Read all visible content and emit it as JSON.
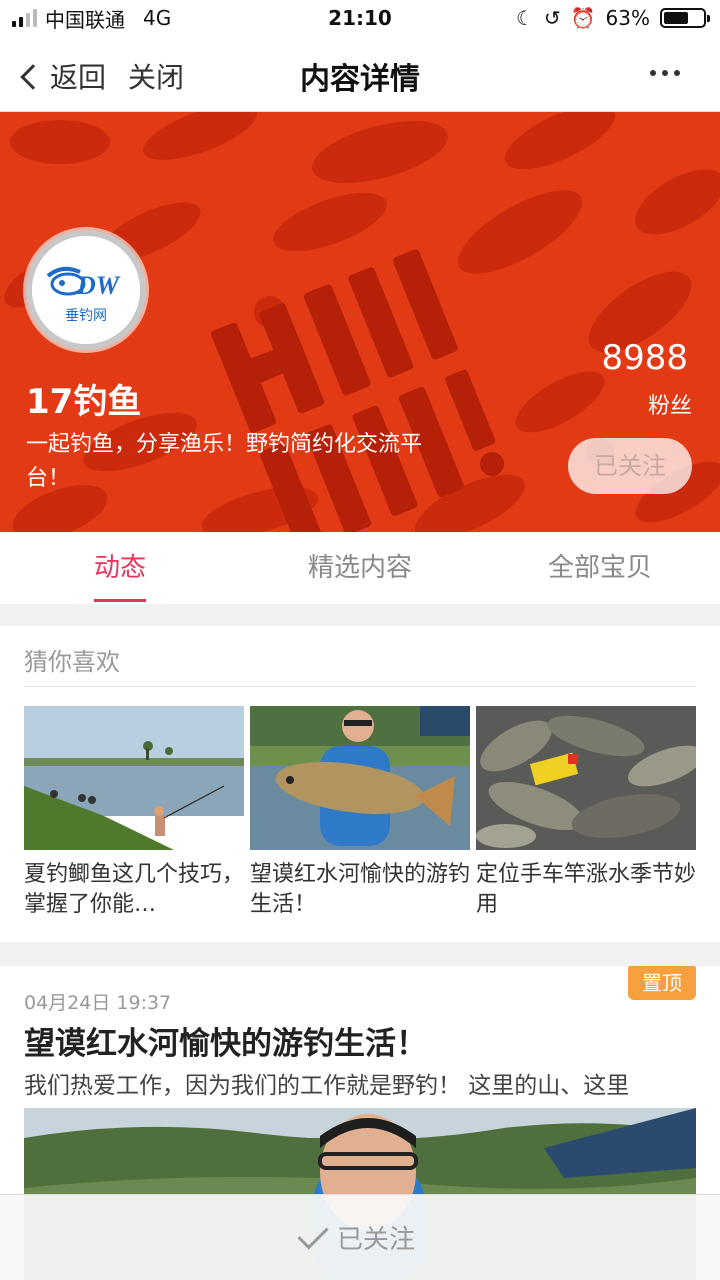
{
  "status_bar": {
    "carrier": "中国联通",
    "network": "4G",
    "time": "21:10",
    "battery": "63%",
    "battery_level": 0.63
  },
  "nav": {
    "back_label": "返回",
    "close_label": "关闭",
    "title": "内容详情"
  },
  "shop": {
    "logo_text": "DW",
    "logo_subtext": "垂钓网",
    "name": "17钓鱼",
    "description": "一起钓鱼，分享渔乐！野钓简约化交流平台！",
    "fans_count": "8988",
    "fans_label": "粉丝",
    "follow_label": "已关注",
    "banner_text": "HAVE FUN!"
  },
  "tabs": [
    {
      "label": "动态",
      "active": true
    },
    {
      "label": "精选内容",
      "active": false
    },
    {
      "label": "全部宝贝",
      "active": false
    }
  ],
  "guess": {
    "title": "猜你喜欢",
    "items": [
      {
        "caption": "夏钓鲫鱼这几个技巧，掌握了你能…"
      },
      {
        "caption": "望谟红水河愉快的游钓生活！"
      },
      {
        "caption": "定位手车竿涨水季节妙用"
      }
    ]
  },
  "post": {
    "badge": "置顶",
    "time": "04月24日 19:37",
    "title": "望谟红水河愉快的游钓生活！",
    "summary": "我们热爱工作，因为我们的工作就是野钓！  这里的山、这里"
  },
  "bottom_bar": {
    "follow_label": "已关注"
  },
  "colors": {
    "banner": "#e23a14",
    "active_tab": "#e8335a",
    "pin_badge": "#f7a040"
  }
}
